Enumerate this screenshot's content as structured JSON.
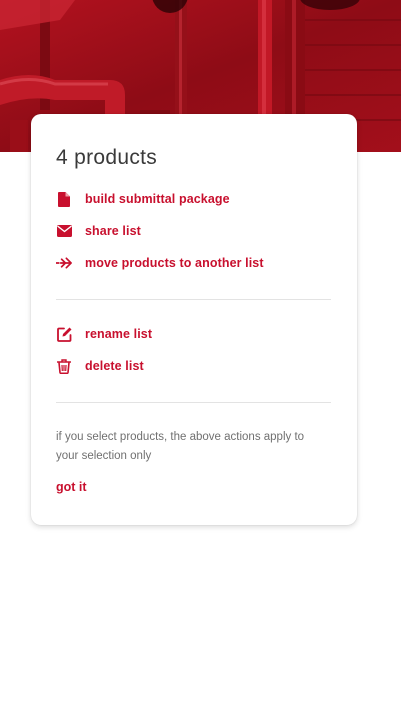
{
  "colors": {
    "accent": "#c8102e",
    "hero": "#a8101c",
    "title_text": "#3a3a3a",
    "note_text": "#707070",
    "divider": "#e3e3e3"
  },
  "card": {
    "title": "4 products",
    "group1": [
      {
        "icon": "document-icon",
        "label": "build submittal package"
      },
      {
        "icon": "envelope-icon",
        "label": "share list"
      },
      {
        "icon": "move-arrow-icon",
        "label": "move products to another list"
      }
    ],
    "group2": [
      {
        "icon": "edit-icon",
        "label": "rename list"
      },
      {
        "icon": "trash-icon",
        "label": "delete list"
      }
    ],
    "note": "if you select products, the above actions apply to your selection only",
    "dismiss_label": "got it"
  }
}
